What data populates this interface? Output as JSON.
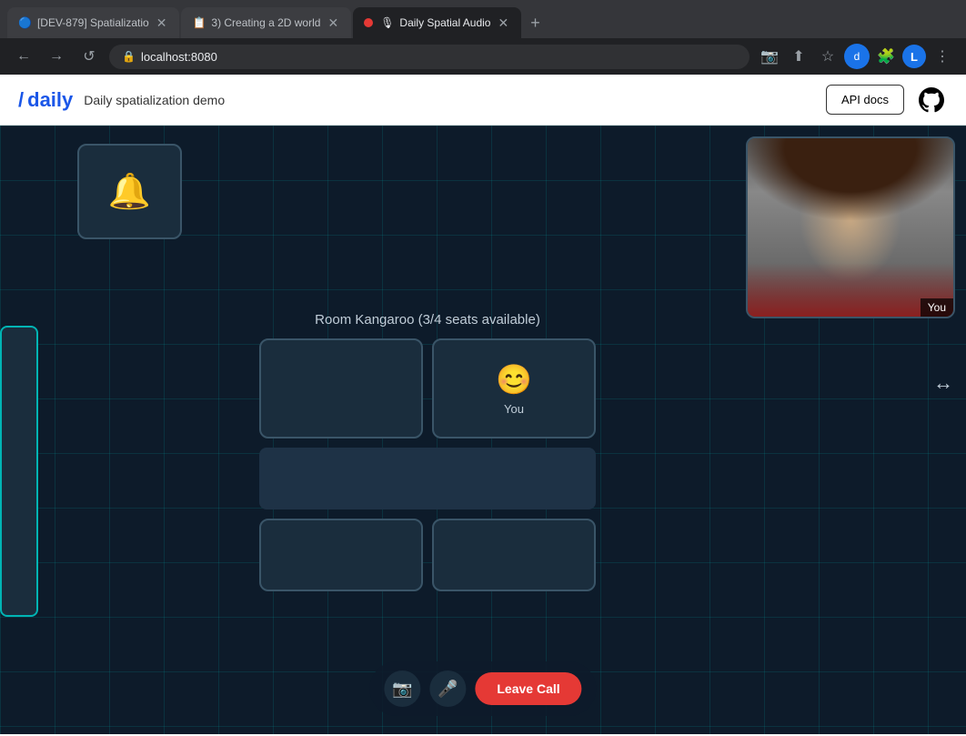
{
  "browser": {
    "tabs": [
      {
        "id": "tab1",
        "label": "[DEV-879] Spatializatio",
        "favicon": "📄",
        "active": false,
        "hasCloseBtn": true
      },
      {
        "id": "tab2",
        "label": "3) Creating a 2D world",
        "favicon": "📝",
        "active": false,
        "hasCloseBtn": true
      },
      {
        "id": "tab3",
        "label": "Daily Spatial Audio",
        "favicon": "🎙",
        "active": true,
        "hasCloseBtn": true,
        "hasIndicator": true
      }
    ],
    "new_tab_label": "+",
    "address": "localhost:8080",
    "nav": {
      "back": "←",
      "forward": "→",
      "refresh": "↺"
    }
  },
  "app_header": {
    "logo": "/daily",
    "title": "Daily spatialization demo",
    "api_docs_label": "API docs",
    "github_label": "GitHub"
  },
  "canvas": {
    "bell_emoji": "🔔",
    "room_kangaroo": {
      "title": "Room Kangaroo (3/4 seats available)",
      "seats": [
        {
          "id": "seat1",
          "occupied": false,
          "emoji": ""
        },
        {
          "id": "seat2",
          "occupied": true,
          "emoji": "😊",
          "label": "You"
        },
        {
          "id": "seat-wide",
          "type": "wide"
        },
        {
          "id": "seat3",
          "occupied": false,
          "emoji": ""
        },
        {
          "id": "seat4",
          "occupied": false,
          "emoji": ""
        }
      ]
    }
  },
  "video_overlay": {
    "label": "You"
  },
  "call_controls": {
    "camera_icon": "📷",
    "mic_icon": "🎤",
    "leave_label": "Leave Call"
  },
  "cursor": {
    "symbol": "↩"
  }
}
